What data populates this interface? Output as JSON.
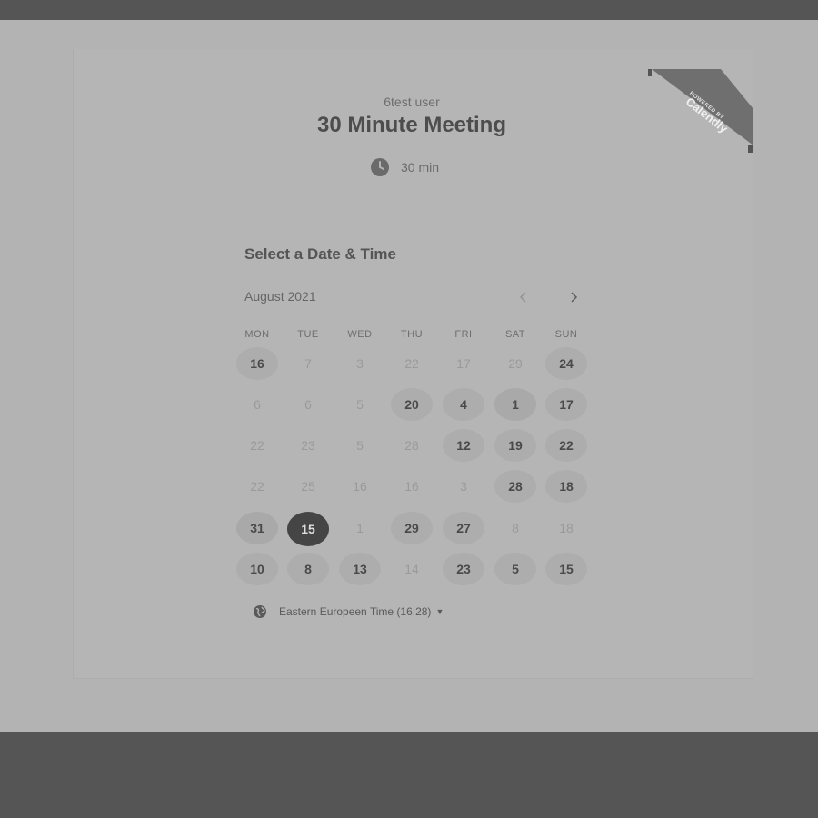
{
  "event": {
    "host": "6test user",
    "title": "30 Minute Meeting",
    "duration": "30 min"
  },
  "badge": {
    "powered": "POWERED BY",
    "brand": "Calendly"
  },
  "calendar": {
    "heading": "Select a Date & Time",
    "month": "August 2021",
    "weekdays": [
      "MON",
      "TUE",
      "WED",
      "THU",
      "FRI",
      "SAT",
      "SUN"
    ],
    "rows": [
      [
        {
          "d": "16",
          "s": "avail"
        },
        {
          "d": "7",
          "s": "off"
        },
        {
          "d": "3",
          "s": "off"
        },
        {
          "d": "22",
          "s": "off"
        },
        {
          "d": "17",
          "s": "off"
        },
        {
          "d": "29",
          "s": "off"
        },
        {
          "d": "24",
          "s": "avail"
        }
      ],
      [
        {
          "d": "6",
          "s": "off"
        },
        {
          "d": "6",
          "s": "off"
        },
        {
          "d": "5",
          "s": "off"
        },
        {
          "d": "20",
          "s": "avail"
        },
        {
          "d": "4",
          "s": "avail"
        },
        {
          "d": "1",
          "s": "light"
        },
        {
          "d": "17",
          "s": "avail"
        }
      ],
      [
        {
          "d": "22",
          "s": "off"
        },
        {
          "d": "23",
          "s": "off"
        },
        {
          "d": "5",
          "s": "off"
        },
        {
          "d": "28",
          "s": "off"
        },
        {
          "d": "12",
          "s": "avail"
        },
        {
          "d": "19",
          "s": "avail"
        },
        {
          "d": "22",
          "s": "avail"
        }
      ],
      [
        {
          "d": "22",
          "s": "off"
        },
        {
          "d": "25",
          "s": "off"
        },
        {
          "d": "16",
          "s": "off"
        },
        {
          "d": "16",
          "s": "off"
        },
        {
          "d": "3",
          "s": "off"
        },
        {
          "d": "28",
          "s": "avail"
        },
        {
          "d": "18",
          "s": "avail"
        }
      ],
      [
        {
          "d": "31",
          "s": "light"
        },
        {
          "d": "15",
          "s": "selected"
        },
        {
          "d": "1",
          "s": "off"
        },
        {
          "d": "29",
          "s": "avail"
        },
        {
          "d": "27",
          "s": "avail"
        },
        {
          "d": "8",
          "s": "off"
        },
        {
          "d": "18",
          "s": "off"
        }
      ],
      [
        {
          "d": "10",
          "s": "avail"
        },
        {
          "d": "8",
          "s": "avail"
        },
        {
          "d": "13",
          "s": "avail"
        },
        {
          "d": "14",
          "s": "off"
        },
        {
          "d": "23",
          "s": "avail"
        },
        {
          "d": "5",
          "s": "avail"
        },
        {
          "d": "15",
          "s": "avail"
        }
      ]
    ]
  },
  "timezone": {
    "label": "Eastern Europeen Time (16:28)"
  },
  "icons": {
    "clock": "clock-icon",
    "globe": "globe-icon",
    "prev": "chevron-left-icon",
    "next": "chevron-right-icon",
    "caret": "caret-down-icon"
  },
  "colors": {
    "selected": "#454545",
    "available": "#adadad",
    "background": "#b3b3b3"
  }
}
